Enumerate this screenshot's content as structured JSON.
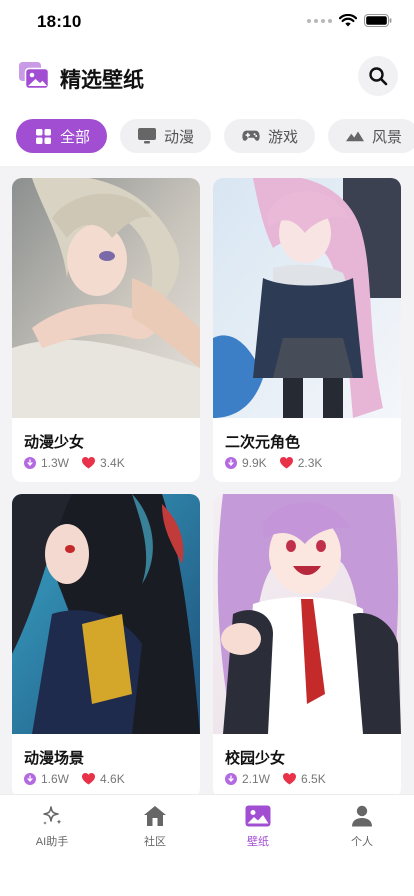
{
  "status_bar": {
    "time": "18:10"
  },
  "header": {
    "title": "精选壁纸"
  },
  "tabs": [
    {
      "label": "全部",
      "icon": "grid-icon",
      "active": true
    },
    {
      "label": "动漫",
      "icon": "monitor-icon",
      "active": false
    },
    {
      "label": "游戏",
      "icon": "gamepad-icon",
      "active": false
    },
    {
      "label": "风景",
      "icon": "mountain-icon",
      "active": false
    }
  ],
  "cards": [
    {
      "title": "动漫少女",
      "downloads": "1.3W",
      "likes": "3.4K"
    },
    {
      "title": "二次元角色",
      "downloads": "9.9K",
      "likes": "2.3K"
    },
    {
      "title": "动漫场景",
      "downloads": "1.6W",
      "likes": "4.6K"
    },
    {
      "title": "校园少女",
      "downloads": "2.1W",
      "likes": "6.5K"
    }
  ],
  "nav": [
    {
      "label": "AI助手",
      "icon": "sparkle-icon",
      "active": false
    },
    {
      "label": "社区",
      "icon": "home-icon",
      "active": false
    },
    {
      "label": "壁纸",
      "icon": "picture-icon",
      "active": true
    },
    {
      "label": "个人",
      "icon": "person-icon",
      "active": false
    }
  ],
  "colors": {
    "accent": "#a24ed3",
    "like": "#e8324a",
    "download": "#b36ae0"
  }
}
